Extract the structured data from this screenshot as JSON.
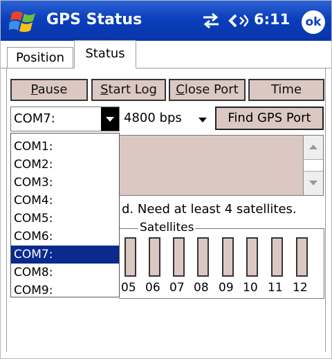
{
  "titlebar": {
    "title": "GPS Status",
    "time": "6:11",
    "ok_label": "ok"
  },
  "tabs": [
    {
      "label": "Position"
    },
    {
      "label": "Status"
    }
  ],
  "buttons": {
    "pause": "Pause",
    "start_log": "Start Log",
    "close_port": "Close Port",
    "time": "Time",
    "find_port": "Find GPS Port"
  },
  "com_select": {
    "value": "COM7:"
  },
  "baud_select": {
    "value": "4800 bps"
  },
  "status_text": "d. Need at least 4 satellites.",
  "satellites": {
    "legend": "Satellites",
    "numbers": [
      "05",
      "06",
      "07",
      "08",
      "09",
      "10",
      "11",
      "12"
    ]
  },
  "com_list": {
    "items": [
      "COM1:",
      "COM2:",
      "COM3:",
      "COM4:",
      "COM5:",
      "COM6:",
      "COM7:",
      "COM8:",
      "COM9:"
    ],
    "selected": "COM7:"
  },
  "colors": {
    "titlebar": "#0b3fbb",
    "button_face": "#dcc8c2",
    "selection": "#0a2a8c"
  }
}
